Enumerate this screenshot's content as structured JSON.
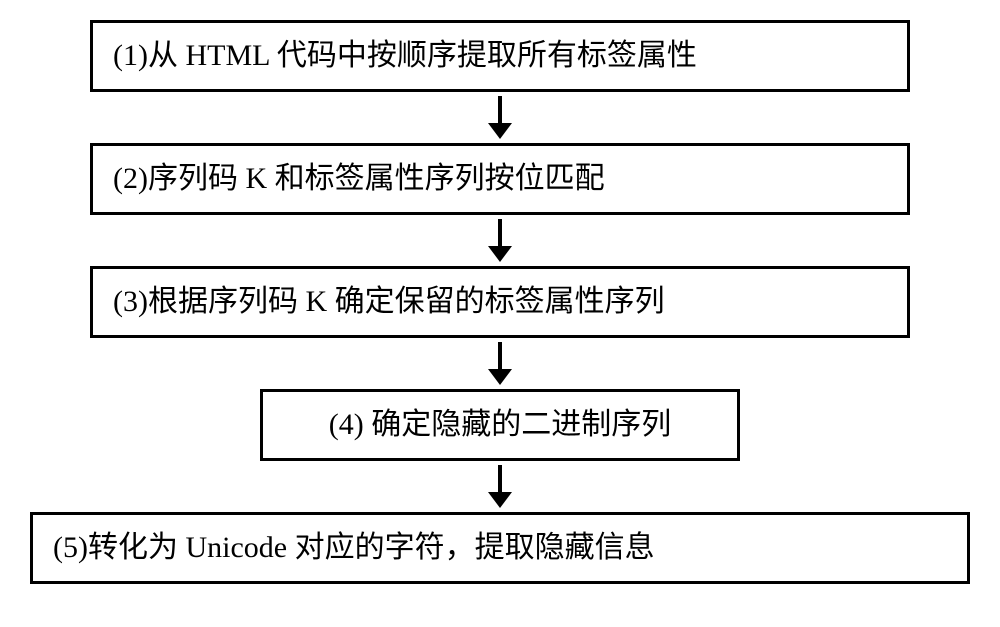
{
  "flowchart": {
    "steps": [
      "(1)从 HTML 代码中按顺序提取所有标签属性",
      "(2)序列码 K 和标签属性序列按位匹配",
      "(3)根据序列码 K 确定保留的标签属性序列",
      "(4) 确定隐藏的二进制序列",
      "(5)转化为 Unicode 对应的字符，提取隐藏信息"
    ]
  }
}
